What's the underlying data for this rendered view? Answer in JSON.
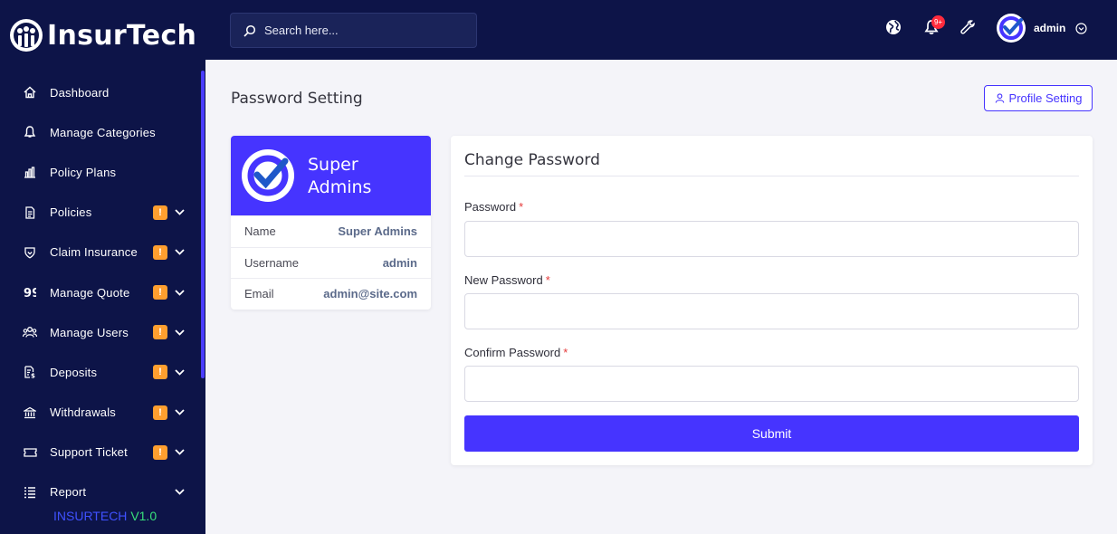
{
  "brand": {
    "name": "InsurTech"
  },
  "sidebar": {
    "items": [
      {
        "label": "Dashboard",
        "icon": "home-icon",
        "badge": "",
        "caret": false
      },
      {
        "label": "Manage Categories",
        "icon": "bell-icon",
        "badge": "",
        "caret": false
      },
      {
        "label": "Policy Plans",
        "icon": "bar-chart-icon",
        "badge": "",
        "caret": false
      },
      {
        "label": "Policies",
        "icon": "document-icon",
        "badge": "!",
        "caret": true
      },
      {
        "label": "Claim Insurance",
        "icon": "shield-icon",
        "badge": "!",
        "caret": true
      },
      {
        "label": "Manage Quote",
        "icon": "quote-icon",
        "badge": "!",
        "caret": true
      },
      {
        "label": "Manage Users",
        "icon": "users-icon",
        "badge": "!",
        "caret": true
      },
      {
        "label": "Deposits",
        "icon": "deposit-icon",
        "badge": "!",
        "caret": true
      },
      {
        "label": "Withdrawals",
        "icon": "bank-icon",
        "badge": "!",
        "caret": true
      },
      {
        "label": "Support Ticket",
        "icon": "ticket-icon",
        "badge": "!",
        "caret": true
      },
      {
        "label": "Report",
        "icon": "list-icon",
        "badge": "",
        "caret": true
      }
    ],
    "version_name": "INSURTECH",
    "version_number": "V1.0"
  },
  "topbar": {
    "search_placeholder": "Search here...",
    "notification_count": "9+",
    "username": "admin"
  },
  "page": {
    "title": "Password Setting",
    "profile_button": "Profile Setting"
  },
  "profile": {
    "name": "Super Admins",
    "rows": [
      {
        "key": "Name",
        "value": "Super Admins"
      },
      {
        "key": "Username",
        "value": "admin"
      },
      {
        "key": "Email",
        "value": "admin@site.com"
      }
    ]
  },
  "form": {
    "title": "Change Password",
    "fields": [
      {
        "label": "Password",
        "required": "*"
      },
      {
        "label": "New Password",
        "required": "*"
      },
      {
        "label": "Confirm Password",
        "required": "*"
      }
    ],
    "submit": "Submit"
  },
  "colors": {
    "sidebar_bg": "#0d1448",
    "accent": "#4634ff",
    "badge": "#ff9f2f",
    "notification": "#ff2b3d"
  }
}
